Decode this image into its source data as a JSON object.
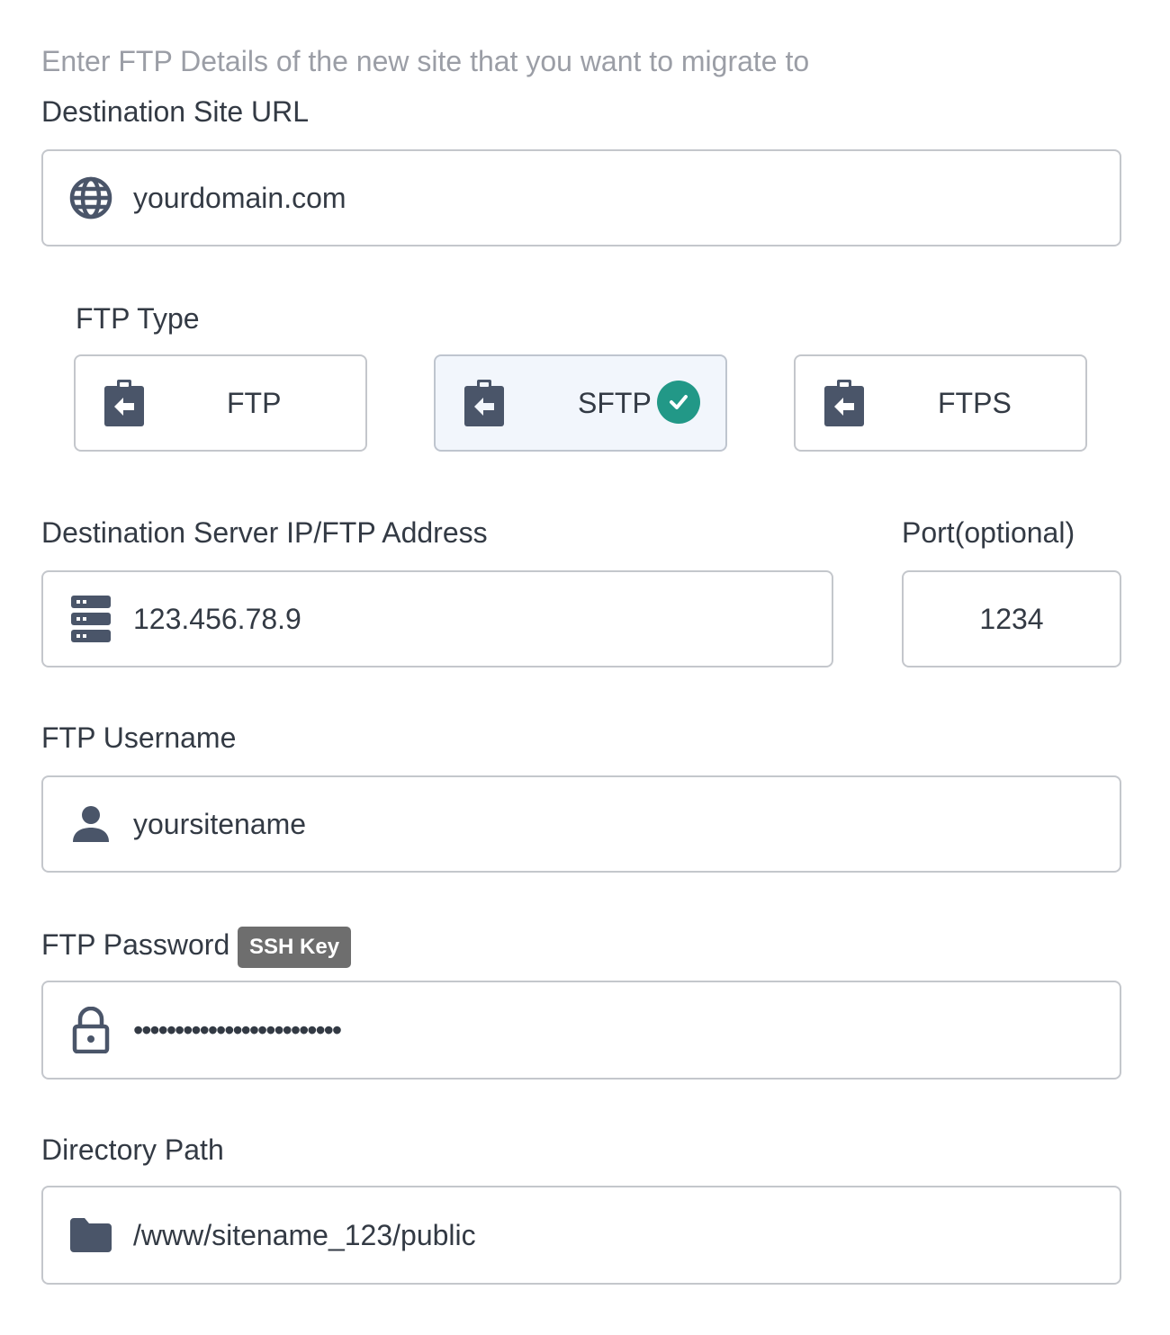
{
  "intro_text": "Enter FTP Details of the new site that you want to migrate to",
  "destination_url": {
    "label": "Destination Site URL",
    "value": "yourdomain.com",
    "icon": "globe-icon"
  },
  "ftp_type": {
    "label": "FTP Type",
    "options": [
      {
        "label": "FTP",
        "icon": "clipboard-arrow-icon",
        "selected": false
      },
      {
        "label": "SFTP",
        "icon": "clipboard-arrow-icon",
        "selected": true
      },
      {
        "label": "FTPS",
        "icon": "clipboard-arrow-icon",
        "selected": false
      }
    ],
    "selected_indicator_icon": "check-circle-icon",
    "accent_color": "#229887"
  },
  "server_address": {
    "label": "Destination Server IP/FTP Address",
    "value": "123.456.78.9",
    "icon": "server-icon"
  },
  "port": {
    "label": "Port(optional)",
    "value": "1234"
  },
  "username": {
    "label": "FTP Username",
    "value": "yoursitename",
    "icon": "user-icon"
  },
  "password": {
    "label": "FTP Password",
    "badge": "SSH Key",
    "value": "•••••••••••••••••••••••••",
    "icon": "lock-icon"
  },
  "directory": {
    "label": "Directory Path",
    "value": "/www/sitename_123/public",
    "icon": "folder-icon"
  },
  "colors": {
    "icon": "#4a5569",
    "border": "#c4c7cc",
    "selected_bg": "#f2f6fc",
    "badge_bg": "#6e6e6e"
  }
}
